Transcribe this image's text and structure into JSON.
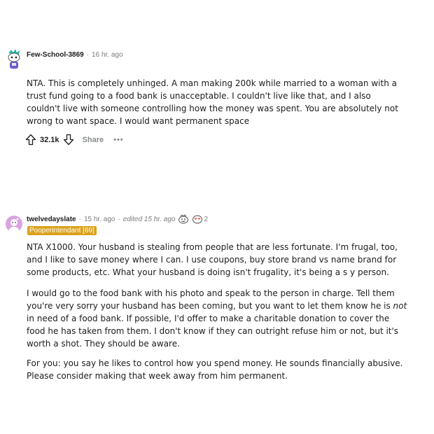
{
  "comments": [
    {
      "author": "Few-School-3869",
      "time": "16 hr. ago",
      "paragraphs": [
        "NTA. This is completely unhinged. A man making 200k while married to a woman with a trust fund going to a food bank is unacceptable. I couldn't live like that, and I also couldn't live with someone controlling how the money was spent. You are absolutely not wrong to want space. I would want permanent space"
      ],
      "vote_count": "32.1k",
      "share_label": "Share",
      "more_label": "•••"
    },
    {
      "author": "twelvedayslate",
      "time": "15 hr. ago",
      "edited": "edited 15 hr. ago",
      "award_count": "2",
      "flair": "Pooperintendant [69]",
      "paragraphs": {
        "p1": "NTA X1000. Your husband is stealing from people that are less fortunate. I'm frugal, too, and I like to save money where I can. I use coupons, buy store brand vs name brand for some products, etc. What your husband is doing isn't frugality, it's being a s      y person.",
        "p2_before": "I would go to the food bank with his photo and speak to the person in charge. Tell them you're very sorry your husband has been coming, but you want to let them know he is ",
        "p2_em": "not",
        "p2_after": " in need of a food bank. If possible, I'd offer to make a charitable donation to cover the food he has taken from them. I don't know if they can outright refuse him or not, but it's worth a shot. They should be aware.",
        "p3": "For you: you say he likes to control how you spend money. He sounds financially abusive. Please consider making that week away from him permanent."
      }
    }
  ],
  "colors": {
    "flair_bg": "#dba21a",
    "meta_text": "#7c7c7c",
    "avatar2_bg": "#d9a3e0"
  }
}
